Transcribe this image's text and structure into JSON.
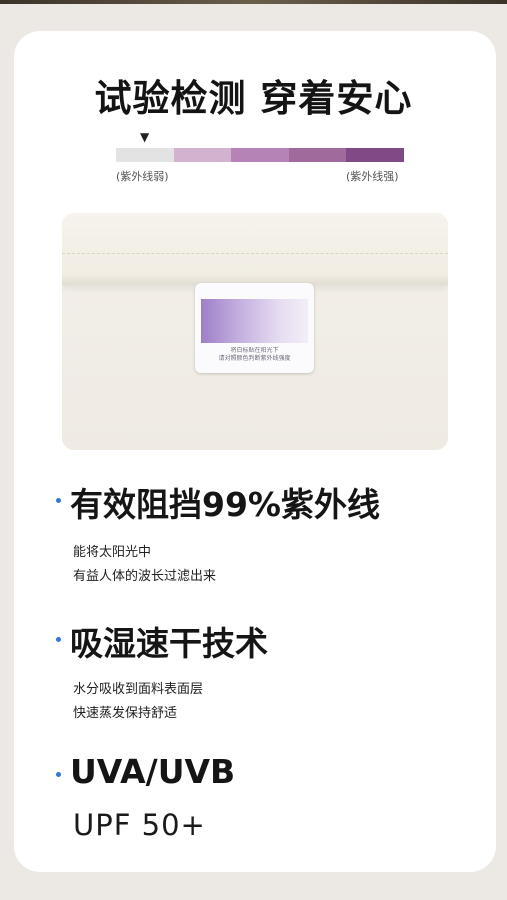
{
  "title": "试验检测 穿着安心",
  "uv_scale": {
    "marker": "▼",
    "weak_label": "(紫外线弱)",
    "strong_label": "(紫外线强)",
    "colors": [
      "#e3e3e3",
      "#d2b3cf",
      "#b683b6",
      "#a06a9c",
      "#7f4a86"
    ]
  },
  "tag": {
    "text_line1": "将白标贴在阳光下",
    "text_line2": "请对照颜色判断紫外线强度"
  },
  "features": [
    {
      "title": "有效阻挡99%紫外线",
      "desc": [
        "能将太阳光中",
        "有益人体的波长过滤出来"
      ]
    },
    {
      "title": "吸湿速干技术",
      "desc": [
        "水分吸收到面料表面层",
        "快速蒸发保持舒适"
      ]
    },
    {
      "title": "UVA/UVB",
      "desc": []
    }
  ],
  "upf": "UPF 50+",
  "accent_color": "#2f78d4"
}
